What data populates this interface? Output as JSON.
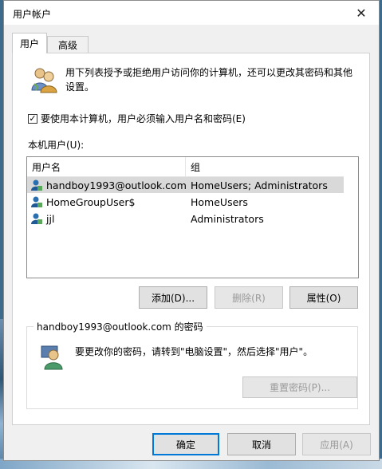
{
  "window": {
    "title": "用户帐户",
    "close_label": "✕"
  },
  "tabs": [
    {
      "label": "用户",
      "active": true
    },
    {
      "label": "高级",
      "active": false
    }
  ],
  "info": {
    "text": "用下列表授予或拒绝用户访问你的计算机，还可以更改其密码和其他设置。"
  },
  "require_login": {
    "label": "要使用本计算机，用户必须输入用户名和密码(E)",
    "checked": true
  },
  "users_label": "本机用户(U):",
  "list": {
    "columns": [
      "用户名",
      "组"
    ],
    "rows": [
      {
        "name": "handboy1993@outlook.com",
        "group": "HomeUsers; Administrators",
        "selected": true
      },
      {
        "name": "HomeGroupUser$",
        "group": "HomeUsers",
        "selected": false
      },
      {
        "name": "jjl",
        "group": "Administrators",
        "selected": false
      }
    ]
  },
  "buttons": {
    "add": "添加(D)...",
    "remove": "删除(R)",
    "properties": "属性(O)"
  },
  "password_group": {
    "title": "handboy1993@outlook.com 的密码",
    "text": "要更改你的密码，请转到\"电脑设置\"，然后选择\"用户\"。",
    "reset_button": "重置密码(P)..."
  },
  "footer": {
    "ok": "确定",
    "cancel": "取消",
    "apply": "应用(A)"
  },
  "colors": {
    "accent": "#0078d7",
    "selection": "#d9d9d9",
    "dialog_bg": "#f0f0f0"
  }
}
